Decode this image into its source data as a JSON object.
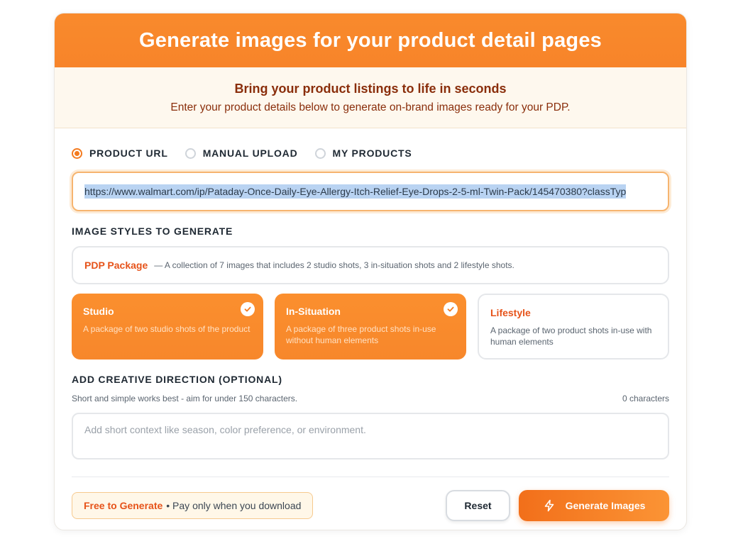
{
  "header": {
    "title": "Generate images for your product detail pages",
    "tagline": "Bring your product listings to life in seconds",
    "subtitle": "Enter your product details below to generate on-brand images ready for your PDP."
  },
  "source_options": [
    {
      "label": "PRODUCT URL",
      "selected": true
    },
    {
      "label": "MANUAL UPLOAD",
      "selected": false
    },
    {
      "label": "MY PRODUCTS",
      "selected": false
    }
  ],
  "url_input": {
    "value": "https://www.walmart.com/ip/Pataday-Once-Daily-Eye-Allergy-Itch-Relief-Eye-Drops-2-5-ml-Twin-Pack/145470380?classTyp"
  },
  "styles_section": {
    "title": "IMAGE STYLES TO GENERATE",
    "package": {
      "name": "PDP Package",
      "description": "— A collection of 7 images that includes 2 studio shots, 3 in-situation shots and 2 lifestyle shots."
    },
    "styles": [
      {
        "title": "Studio",
        "description": "A package of two studio shots of the product",
        "selected": true
      },
      {
        "title": "In-Situation",
        "description": "A package of three product shots in-use without human elements",
        "selected": true
      },
      {
        "title": "Lifestyle",
        "description": "A package of two product shots in-use with human elements",
        "selected": false
      }
    ]
  },
  "direction": {
    "title": "ADD CREATIVE DIRECTION (OPTIONAL)",
    "hint": "Short and simple works best - aim for under 150 characters.",
    "counter": "0 characters",
    "placeholder": "Add short context like season, color preference, or environment."
  },
  "footer": {
    "free_label": "Free to Generate",
    "free_note": "• Pay only when you download",
    "reset_label": "Reset",
    "generate_label": "Generate Images"
  },
  "colors": {
    "accent": "#f7872b",
    "accent_text": "#e6531a",
    "subtitle_text": "#8a2e0b"
  },
  "icons": {
    "check": "check-icon",
    "generate": "lightning-icon"
  }
}
